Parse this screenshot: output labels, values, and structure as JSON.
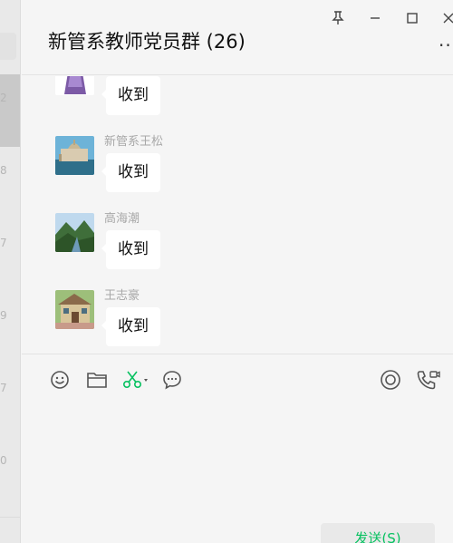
{
  "window": {
    "title": "新管系教师党员群 (26)",
    "controls": [
      "pin-icon",
      "minimize-icon",
      "maximize-icon",
      "close-icon"
    ],
    "more_label": "···"
  },
  "left_strip": {
    "digits": [
      "2",
      "8",
      "7",
      "9",
      "7",
      "0"
    ]
  },
  "messages": [
    {
      "sender": "",
      "text": "收到",
      "avatar": "avatar-purple-dress"
    },
    {
      "sender": "新管系王松",
      "text": "收到",
      "avatar": "avatar-venice"
    },
    {
      "sender": "高海潮",
      "text": "收到",
      "avatar": "avatar-mountain"
    },
    {
      "sender": "王志豪",
      "text": "收到",
      "avatar": "avatar-cottage"
    }
  ],
  "toolbar": {
    "left_tools": [
      "emoji-icon",
      "folder-icon",
      "screenshot-scissors-icon",
      "chat-history-icon"
    ],
    "right_tools": [
      "live-icon",
      "voice-video-call-icon"
    ],
    "accent_color": "#07c160"
  },
  "send_button": {
    "label": "发送(S)"
  }
}
